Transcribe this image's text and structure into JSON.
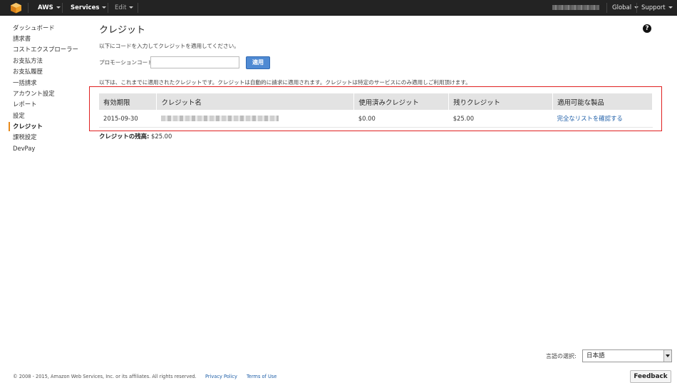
{
  "nav": {
    "brand": "AWS",
    "services": "Services",
    "edit": "Edit",
    "region": "Global",
    "support": "Support"
  },
  "sidebar": {
    "items": [
      {
        "label": "ダッシュボード"
      },
      {
        "label": "請求書"
      },
      {
        "label": "コストエクスプローラー"
      },
      {
        "label": "お支払方法"
      },
      {
        "label": "お支払履歴"
      },
      {
        "label": "一括請求"
      },
      {
        "label": "アカウント設定"
      },
      {
        "label": "レポート"
      },
      {
        "label": "設定"
      },
      {
        "label": "クレジット",
        "active": true
      },
      {
        "label": "課税設定"
      },
      {
        "label": "DevPay"
      }
    ]
  },
  "main": {
    "title": "クレジット",
    "help_icon": "?",
    "intro": "以下にコードを入力してクレジットを適用してください。",
    "promo_label": "プロモーションコード:",
    "promo_value": "",
    "apply_button": "適用",
    "description": "以下は、これまでに適用されたクレジットです。クレジットは自動的に請求に適用されます。クレジットは特定のサービスにのみ適用しご利用頂けます。",
    "table": {
      "headers": [
        "有効期限",
        "クレジット名",
        "使用済みクレジット",
        "残りクレジット",
        "適用可能な製品"
      ],
      "rows": [
        {
          "expiry": "2015-09-30",
          "used": "$0.00",
          "remaining": "$25.00",
          "products_link": "完全なリストを確認する"
        }
      ]
    },
    "balance_label": "クレジットの残高:",
    "balance_value": "$25.00"
  },
  "language": {
    "label": "言語の選択:",
    "selected": "日本語"
  },
  "footer": {
    "copyright": "© 2008 - 2015, Amazon Web Services, Inc. or its affiliates. All rights reserved.",
    "privacy": "Privacy Policy",
    "terms": "Terms of Use",
    "feedback": "Feedback"
  },
  "colors": {
    "nav_bg": "#232323",
    "accent": "#e88a1c",
    "button_blue": "#4f8ad3",
    "link": "#1f5fa8",
    "highlight": "#e02020"
  }
}
